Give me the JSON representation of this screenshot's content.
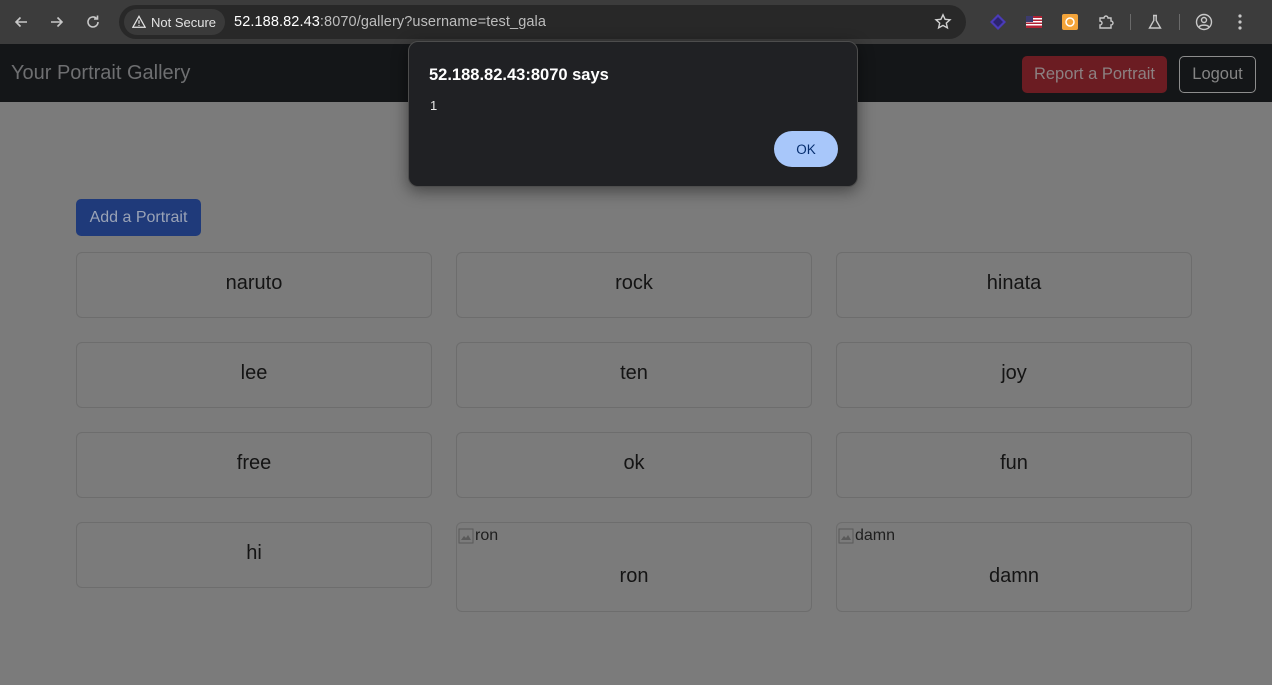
{
  "browser": {
    "security_label": "Not Secure",
    "url_host": "52.188.82.43",
    "url_rest": ":8070/gallery?username=test_gala"
  },
  "navbar": {
    "brand": "Your Portrait Gallery",
    "report_label": "Report a Portrait",
    "logout_label": "Logout"
  },
  "gallery": {
    "add_label": "Add a Portrait",
    "cards": [
      {
        "title": "naruto"
      },
      {
        "title": "rock"
      },
      {
        "title": "hinata"
      },
      {
        "title": "lee"
      },
      {
        "title": "ten"
      },
      {
        "title": "joy"
      },
      {
        "title": "free"
      },
      {
        "title": "ok"
      },
      {
        "title": "fun"
      },
      {
        "title": "hi"
      },
      {
        "title": "ron",
        "image_alt": "ron"
      },
      {
        "title": "damn",
        "image_alt": "damn"
      }
    ]
  },
  "dialog": {
    "title": "52.188.82.43:8070 says",
    "message": "1",
    "ok_label": "OK"
  },
  "icons": [
    "back-icon",
    "forward-icon",
    "reload-icon",
    "warning-icon",
    "star-icon",
    "extension-icon",
    "flag-icon",
    "puzzle-icon",
    "lab-icon",
    "profile-icon",
    "menu-icon",
    "broken-image-icon"
  ]
}
